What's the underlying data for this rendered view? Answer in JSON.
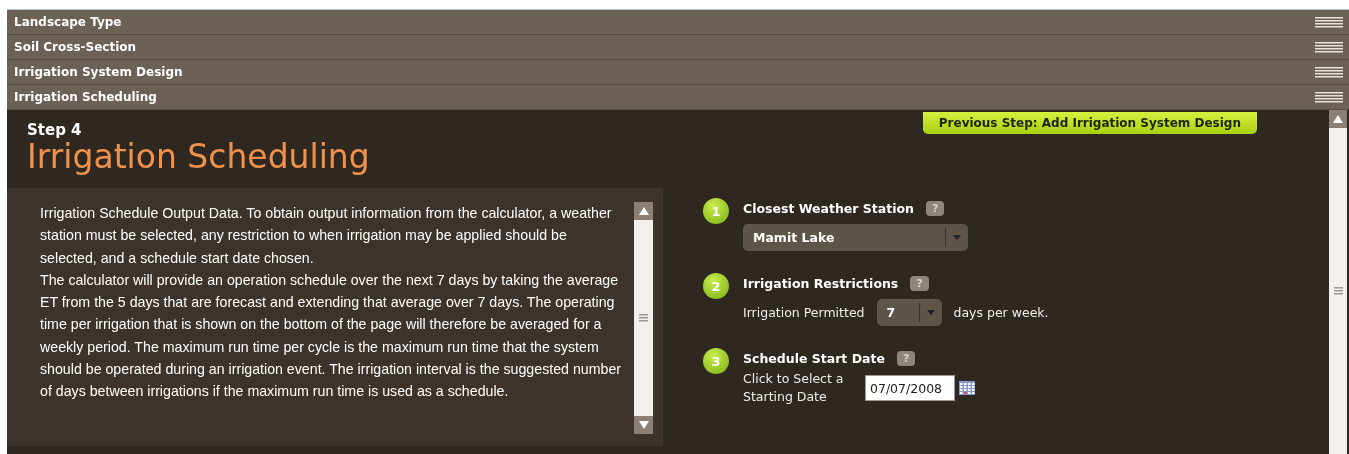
{
  "sections": [
    "Landscape Type",
    "Soil Cross-Section",
    "Irrigation System Design",
    "Irrigation Scheduling"
  ],
  "step": {
    "label": "Step 4",
    "title": "Irrigation Scheduling"
  },
  "previous_button": "Previous Step: Add Irrigation System Design",
  "description": [
    "Irrigation Schedule Output Data. To obtain output information from the calculator, a weather station must be selected, any restriction to when irrigation may be applied should be selected, and a schedule start date chosen.",
    "The calculator will provide an operation schedule over the next 7 days by taking the average ET from the 5 days that are forecast and extending that average over 7 days. The operating time per irrigation that is shown on the bottom of the page will therefore be averaged for a weekly period. The maximum run time per cycle is the maximum run time that the system should be operated during an irrigation event. The irrigation interval is the suggested number of days between irrigations if the maximum run time is used as a schedule."
  ],
  "steps": [
    {
      "number": "1",
      "title": "Closest Weather Station",
      "help": "?",
      "kind": "station",
      "value": "Mamit Lake"
    },
    {
      "number": "2",
      "title": "Irrigation Restrictions",
      "help": "?",
      "kind": "restriction",
      "label": "Irrigation Permitted",
      "value": "7",
      "suffix": "days per week."
    },
    {
      "number": "3",
      "title": "Schedule Start Date",
      "help": "?",
      "kind": "date",
      "label": "Click to Select a Starting Date",
      "value": "07/07/2008"
    }
  ]
}
